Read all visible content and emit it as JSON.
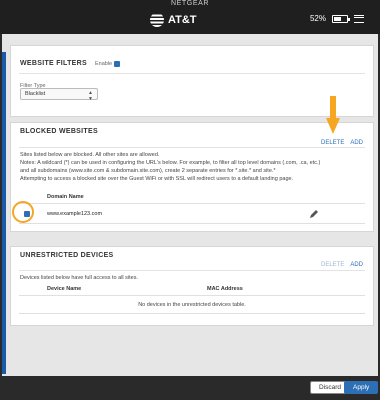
{
  "topbar": {
    "brand": "NETGEAR",
    "carrier": "AT&T",
    "battery_percent": "52%",
    "icons": [
      "att-globe-icon",
      "battery-icon",
      "menu-icon"
    ]
  },
  "website_filters": {
    "title": "WEBSITE FILTERS",
    "enable_label": "Enable",
    "enabled": true,
    "filter_type_label": "Filter Type",
    "filter_type_value": "Blacklist"
  },
  "blocked_websites": {
    "title": "BLOCKED WEBSITES",
    "delete_label": "DELETE",
    "add_label": "ADD",
    "description_lines": [
      "Sites listed below are blocked. All other sites are allowed.",
      "Notes: A wildcard (*) can be used in configuring the URL's below. For example, to filter all top level domains (.com, .ca, etc.)",
      "and all subdomains (www.site.com & subdomain.site.com), create 2 separate entries for *.site.* and site.*",
      "Attempting to access a blocked site over the Guest WiFi or with SSL will redirect users to a default landing page."
    ],
    "column_header": "Domain Name",
    "rows": [
      {
        "domain": "www.example123.com",
        "selected": true
      }
    ]
  },
  "unrestricted_devices": {
    "title": "UNRESTRICTED DEVICES",
    "delete_label": "DELETE",
    "add_label": "ADD",
    "description": "Devices listed below have full access to all sites.",
    "columns": [
      "Device Name",
      "MAC Address"
    ],
    "empty_message": "No devices in the unrestricted devices table."
  },
  "footer": {
    "discard_label": "Discard",
    "apply_label": "Apply"
  },
  "colors": {
    "accent": "#2c6fb5",
    "callout": "#f5a623",
    "topbar": "#1f1f1f"
  }
}
